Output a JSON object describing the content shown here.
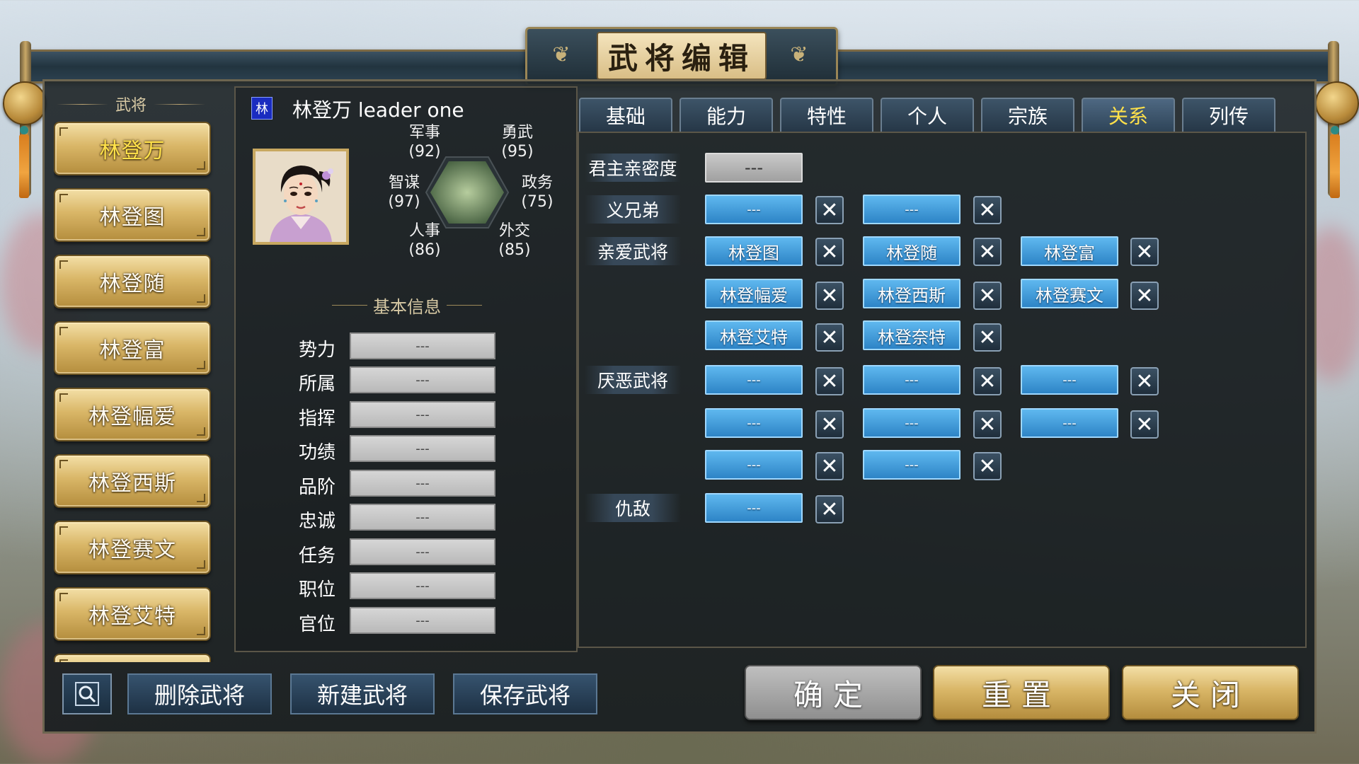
{
  "window": {
    "title": "武将编辑"
  },
  "general_list": {
    "header": "武将",
    "items": [
      {
        "label": "林登万",
        "selected": true
      },
      {
        "label": "林登图",
        "selected": false
      },
      {
        "label": "林登随",
        "selected": false
      },
      {
        "label": "林登富",
        "selected": false
      },
      {
        "label": "林登幅爱",
        "selected": false
      },
      {
        "label": "林登西斯",
        "selected": false
      },
      {
        "label": "林登赛文",
        "selected": false
      },
      {
        "label": "林登艾特",
        "selected": false
      }
    ]
  },
  "profile": {
    "faction_badge": "林",
    "faction_color": "#1a2cc0",
    "name": "林登万 leader one",
    "stats": {
      "military": {
        "label": "军事",
        "value": "(92)"
      },
      "bravery": {
        "label": "勇武",
        "value": "(95)"
      },
      "strategy": {
        "label": "智谋",
        "value": "(97)"
      },
      "politics": {
        "label": "政务",
        "value": "(75)"
      },
      "personnel": {
        "label": "人事",
        "value": "(86)"
      },
      "diplomacy": {
        "label": "外交",
        "value": "(85)"
      }
    }
  },
  "basic_info": {
    "title": "基本信息",
    "fields": [
      {
        "label": "势力",
        "value": "---"
      },
      {
        "label": "所属",
        "value": "---"
      },
      {
        "label": "指挥",
        "value": "---"
      },
      {
        "label": "功绩",
        "value": "---"
      },
      {
        "label": "品阶",
        "value": "---"
      },
      {
        "label": "忠诚",
        "value": "---"
      },
      {
        "label": "任务",
        "value": "---"
      },
      {
        "label": "职位",
        "value": "---"
      },
      {
        "label": "官位",
        "value": "---"
      }
    ]
  },
  "tabs": [
    {
      "label": "基础",
      "active": false
    },
    {
      "label": "能力",
      "active": false
    },
    {
      "label": "特性",
      "active": false
    },
    {
      "label": "个人",
      "active": false
    },
    {
      "label": "宗族",
      "active": false
    },
    {
      "label": "关系",
      "active": true
    },
    {
      "label": "列传",
      "active": false
    }
  ],
  "relations": {
    "lord_affinity": {
      "label": "君主亲密度",
      "value": "---"
    },
    "sworn_brothers": {
      "label": "义兄弟",
      "values": [
        "---",
        "---"
      ]
    },
    "favored": {
      "label": "亲爱武将",
      "values": [
        "林登图",
        "林登随",
        "林登富",
        "林登幅爱",
        "林登西斯",
        "林登赛文",
        "林登艾特",
        "林登奈特"
      ]
    },
    "disliked": {
      "label": "厌恶武将",
      "values": [
        "---",
        "---",
        "---",
        "---",
        "---",
        "---",
        "---",
        "---"
      ]
    },
    "enemy": {
      "label": "仇敌",
      "values": [
        "---"
      ]
    },
    "remove_symbol": "✕"
  },
  "bottom_bar": {
    "search_icon": "search-icon",
    "delete_label": "删除武将",
    "new_label": "新建武将",
    "save_label": "保存武将",
    "confirm_label": "确定",
    "reset_label": "重置",
    "close_label": "关闭"
  }
}
